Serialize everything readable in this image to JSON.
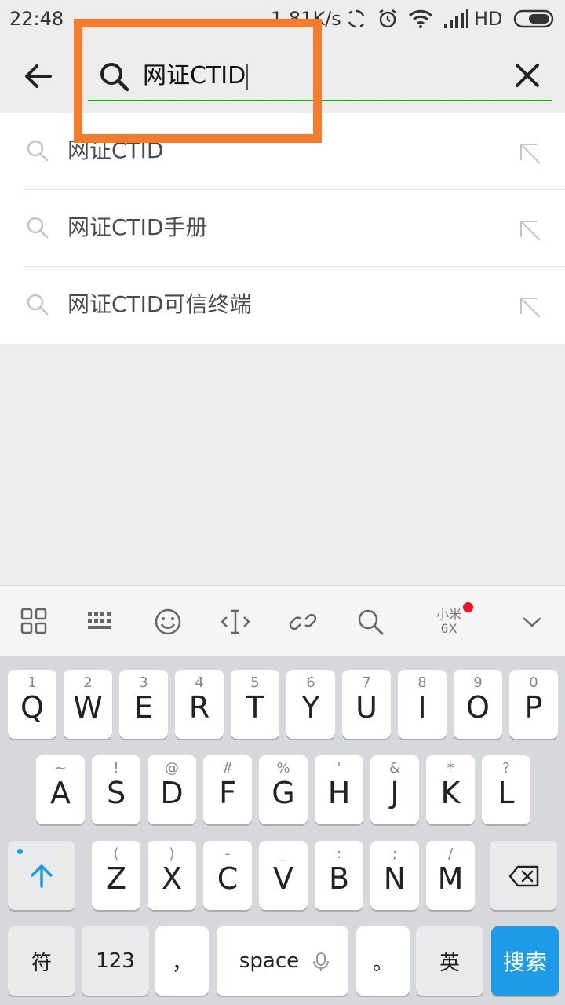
{
  "status_bar": {
    "time": "22:48",
    "net_speed": "1.81K/s",
    "network_label": "HD",
    "icons": [
      "sync-icon",
      "alarm-icon",
      "wifi-icon",
      "signal-icon",
      "battery-icon"
    ]
  },
  "search": {
    "query": "网证CTID",
    "icons": {
      "back": "back-arrow-icon",
      "search": "search-icon",
      "clear": "close-icon"
    }
  },
  "suggestions": [
    {
      "text": "网证CTID"
    },
    {
      "text": "网证CTID手册"
    },
    {
      "text": "网证CTID可信终端"
    }
  ],
  "keyboard_toolbar": {
    "items": [
      "grid-menu-icon",
      "keyboard-icon",
      "emoji-icon",
      "cursor-icon",
      "link-icon",
      "search-icon",
      "brand-logo",
      "collapse-icon"
    ],
    "brand_line1": "小米",
    "brand_line2": "6X"
  },
  "keyboard": {
    "row1": [
      {
        "hint": "1",
        "key": "Q"
      },
      {
        "hint": "2",
        "key": "W"
      },
      {
        "hint": "3",
        "key": "E"
      },
      {
        "hint": "4",
        "key": "R"
      },
      {
        "hint": "5",
        "key": "T"
      },
      {
        "hint": "6",
        "key": "Y"
      },
      {
        "hint": "7",
        "key": "U"
      },
      {
        "hint": "8",
        "key": "I"
      },
      {
        "hint": "9",
        "key": "O"
      },
      {
        "hint": "0",
        "key": "P"
      }
    ],
    "row2": [
      {
        "hint": "~",
        "key": "A"
      },
      {
        "hint": "!",
        "key": "S"
      },
      {
        "hint": "@",
        "key": "D"
      },
      {
        "hint": "#",
        "key": "F"
      },
      {
        "hint": "%",
        "key": "G"
      },
      {
        "hint": "'",
        "key": "H"
      },
      {
        "hint": "&",
        "key": "J"
      },
      {
        "hint": "*",
        "key": "K"
      },
      {
        "hint": "?",
        "key": "L"
      }
    ],
    "row3": [
      {
        "hint": "(",
        "key": "Z"
      },
      {
        "hint": ")",
        "key": "X"
      },
      {
        "hint": "-",
        "key": "C"
      },
      {
        "hint": "_",
        "key": "V"
      },
      {
        "hint": ":",
        "key": "B"
      },
      {
        "hint": ";",
        "key": "N"
      },
      {
        "hint": "/",
        "key": "M"
      }
    ],
    "bottom": {
      "symbols": "符",
      "numbers": "123",
      "comma": "，",
      "space": "space",
      "period": "。",
      "lang": "英",
      "search": "搜索"
    }
  },
  "colors": {
    "highlight": "#f57b2d",
    "underline": "#1aad19",
    "search_key": "#1e9be8",
    "badge": "#f0141e"
  }
}
